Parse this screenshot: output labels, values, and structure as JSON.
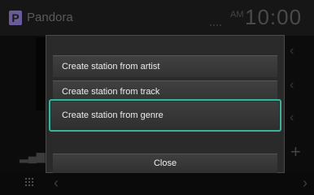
{
  "header": {
    "app_icon_letter": "P",
    "app_title": "Pandora",
    "clock_ampm": "AM",
    "clock_time": "10:00"
  },
  "background": {
    "plus_symbol": "+",
    "chevron_right": "‹",
    "back_symbol": "‹",
    "forward_symbol": "›",
    "eq_symbol": "▂▄▆"
  },
  "dialog": {
    "items": [
      {
        "label": "Create station from artist"
      },
      {
        "label": "Create station from track"
      },
      {
        "label": "Create station from genre",
        "selected": true
      }
    ],
    "close_label": "Close"
  },
  "colors": {
    "selection_border": "#3ab39a",
    "dialog_bg": "#2a2a2a"
  }
}
